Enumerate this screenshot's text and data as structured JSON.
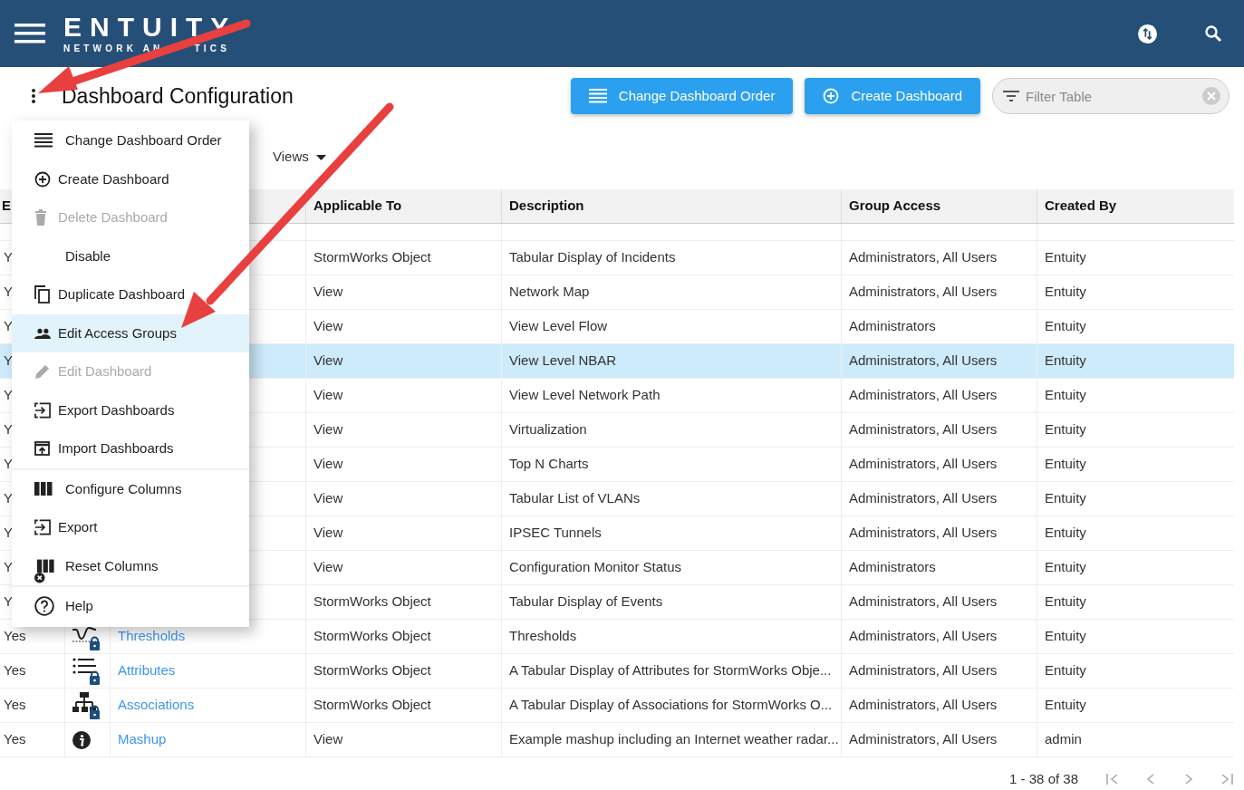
{
  "header": {
    "logo_title": "ENTUITY",
    "logo_subtitle": [
      "NETWORK AN",
      "TICS"
    ]
  },
  "page_title": "Dashboard Configuration",
  "buttons": [
    {
      "kind": "order",
      "label": "Change Dashboard Order"
    },
    {
      "kind": "create",
      "label": "Create Dashboard"
    }
  ],
  "filter": {
    "placeholder": "Filter Table"
  },
  "views": {
    "label": "Views"
  },
  "menu": {
    "sections": [
      [
        {
          "kind": "order",
          "label": "Change Dashboard Order",
          "disabled": false,
          "selected": false
        },
        {
          "kind": "create",
          "label": "Create Dashboard",
          "disabled": false,
          "selected": false
        },
        {
          "kind": "delete",
          "label": "Delete Dashboard",
          "disabled": true,
          "selected": false
        },
        {
          "kind": "none",
          "label": "Disable",
          "disabled": false,
          "selected": false
        },
        {
          "kind": "duplicate",
          "label": "Duplicate Dashboard",
          "disabled": false,
          "selected": false
        },
        {
          "kind": "people",
          "label": "Edit Access Groups",
          "disabled": false,
          "selected": true
        },
        {
          "kind": "edit",
          "label": "Edit Dashboard",
          "disabled": true,
          "selected": false
        },
        {
          "kind": "export",
          "label": "Export Dashboards",
          "disabled": false,
          "selected": false
        },
        {
          "kind": "import",
          "label": "Import Dashboards",
          "disabled": false,
          "selected": false
        }
      ],
      [
        {
          "kind": "columns",
          "label": "Configure Columns",
          "disabled": false,
          "selected": false
        },
        {
          "kind": "export",
          "label": "Export",
          "disabled": false,
          "selected": false
        },
        {
          "kind": "reset",
          "label": "Reset Columns",
          "disabled": false,
          "selected": false
        }
      ],
      [
        {
          "kind": "help",
          "label": "Help",
          "disabled": false,
          "selected": false
        }
      ]
    ]
  },
  "table": {
    "columns": [
      "E",
      "Applicable To",
      "Description",
      "Group Access",
      "Created By"
    ],
    "rows": [
      {
        "enabled": "Y",
        "kind": "none",
        "applicable": "StormWorks Object",
        "description": "Tabular Display of Incidents",
        "group": "Administrators, All Users",
        "created_by": "Entuity",
        "selected": false
      },
      {
        "enabled": "Y",
        "kind": "none",
        "applicable": "View",
        "description": "Network Map",
        "group": "Administrators, All Users",
        "created_by": "Entuity",
        "selected": false
      },
      {
        "enabled": "Y",
        "kind": "none",
        "applicable": "View",
        "description": "View Level Flow",
        "group": "Administrators",
        "created_by": "Entuity",
        "selected": false
      },
      {
        "enabled": "Y",
        "kind": "none",
        "applicable": "View",
        "description": "View Level NBAR",
        "group": "Administrators, All Users",
        "created_by": "Entuity",
        "selected": true
      },
      {
        "enabled": "Y",
        "kind": "none",
        "applicable": "View",
        "description": "View Level Network Path",
        "group": "Administrators, All Users",
        "created_by": "Entuity",
        "selected": false
      },
      {
        "enabled": "Y",
        "kind": "none",
        "applicable": "View",
        "description": "Virtualization",
        "group": "Administrators, All Users",
        "created_by": "Entuity",
        "selected": false
      },
      {
        "enabled": "Y",
        "kind": "none",
        "applicable": "View",
        "description": "Top N Charts",
        "group": "Administrators, All Users",
        "created_by": "Entuity",
        "selected": false
      },
      {
        "enabled": "Y",
        "kind": "none",
        "applicable": "View",
        "description": "Tabular List of VLANs",
        "group": "Administrators, All Users",
        "created_by": "Entuity",
        "selected": false
      },
      {
        "enabled": "Y",
        "kind": "none",
        "applicable": "View",
        "description": "IPSEC Tunnels",
        "group": "Administrators, All Users",
        "created_by": "Entuity",
        "selected": false
      },
      {
        "enabled": "Y",
        "kind": "none",
        "applicable": "View",
        "description": "Configuration Monitor Status",
        "group": "Administrators",
        "created_by": "Entuity",
        "selected": false
      },
      {
        "enabled": "Y",
        "kind": "none",
        "applicable": "StormWorks Object",
        "description": "Tabular Display of Events",
        "group": "Administrators, All Users",
        "created_by": "Entuity",
        "selected": false
      },
      {
        "enabled": "Yes",
        "kind": "threshold",
        "name": "Thresholds",
        "applicable": "StormWorks Object",
        "description": "Thresholds",
        "group": "Administrators, All Users",
        "created_by": "Entuity",
        "selected": false
      },
      {
        "enabled": "Yes",
        "kind": "list",
        "name": "Attributes",
        "applicable": "StormWorks Object",
        "description": "A Tabular Display of Attributes for StormWorks Obje...",
        "group": "Administrators, All Users",
        "created_by": "Entuity",
        "selected": false
      },
      {
        "enabled": "Yes",
        "kind": "hierarchy",
        "name": "Associations",
        "applicable": "StormWorks Object",
        "description": "A Tabular Display of Associations for StormWorks O...",
        "group": "Administrators, All Users",
        "created_by": "Entuity",
        "selected": false
      },
      {
        "enabled": "Yes",
        "kind": "info",
        "name": "Mashup",
        "applicable": "View",
        "description": "Example mashup including an Internet weather radar...",
        "group": "Administrators, All Users",
        "created_by": "admin",
        "selected": false
      }
    ]
  },
  "pagination": {
    "range": "1 - 38 of 38"
  }
}
